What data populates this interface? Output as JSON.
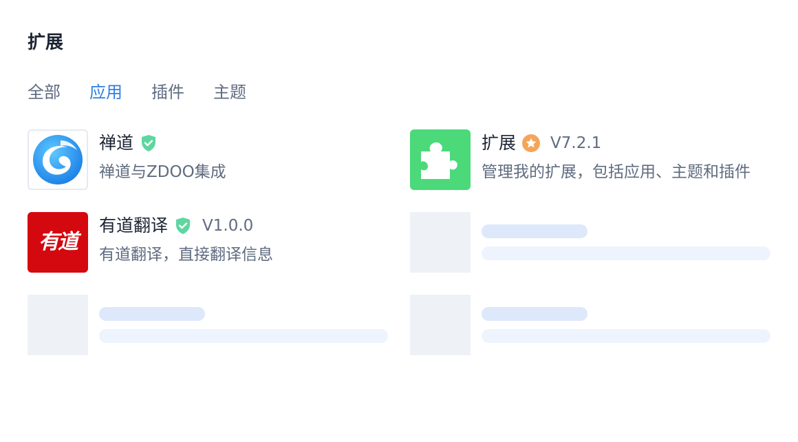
{
  "page": {
    "title": "扩展"
  },
  "tabs": [
    {
      "label": "全部",
      "active": false
    },
    {
      "label": "应用",
      "active": true
    },
    {
      "label": "插件",
      "active": false
    },
    {
      "label": "主题",
      "active": false
    }
  ],
  "apps": [
    {
      "name": "禅道",
      "badge": "verified-shield-icon",
      "version": "",
      "description": "禅道与ZDOO集成",
      "icon": "zentao-logo-icon"
    },
    {
      "name": "扩展",
      "badge": "star-badge-icon",
      "version": "V7.2.1",
      "description": "管理我的扩展，包括应用、主题和插件",
      "icon": "puzzle-piece-icon"
    },
    {
      "name": "有道翻译",
      "badge": "verified-shield-icon",
      "version": "V1.0.0",
      "description": "有道翻译，直接翻译信息",
      "icon": "youdao-logo-icon",
      "icon_text": "有道"
    }
  ],
  "colors": {
    "accent": "#2e7fe0",
    "verified": "#5ed6a0",
    "star": "#f5a55a",
    "extension_bg": "#4bd97a",
    "youdao_bg": "#d4080f",
    "skeleton": "#eef2f7"
  }
}
